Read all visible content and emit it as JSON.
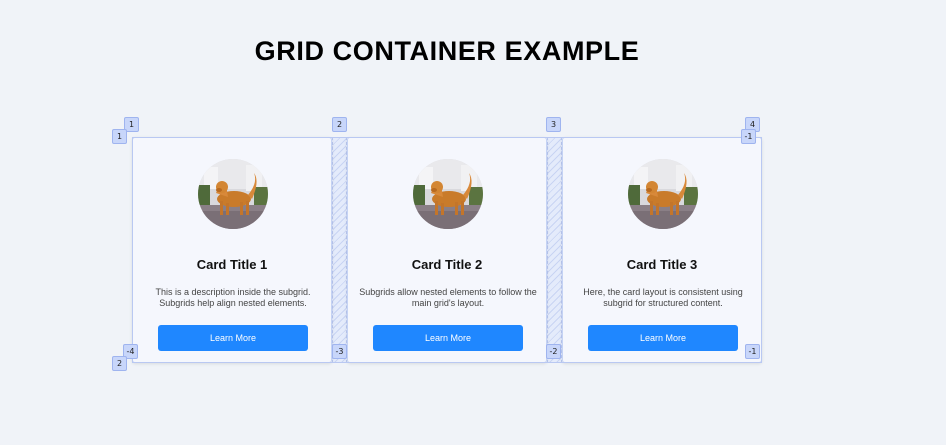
{
  "page": {
    "title": "GRID CONTAINER EXAMPLE"
  },
  "cards": [
    {
      "title": "Card Title 1",
      "description": "This is a description inside the subgrid. Subgrids help align nested elements.",
      "button_label": "Learn More",
      "image": "golden-retriever-photo"
    },
    {
      "title": "Card Title 2",
      "description": "Subgrids allow nested elements to follow the main grid's layout.",
      "button_label": "Learn More",
      "image": "golden-retriever-photo"
    },
    {
      "title": "Card Title 3",
      "description": "Here, the card layout is consistent using subgrid for structured content.",
      "button_label": "Learn More",
      "image": "golden-retriever-photo"
    }
  ],
  "grid_overlay": {
    "column_lines_top": [
      "1",
      "2",
      "3",
      "4"
    ],
    "column_lines_bottom": [
      "-4",
      "-3",
      "-2",
      "-1"
    ],
    "row_lines_left": [
      "1",
      "2"
    ],
    "row_lines_right": [
      "-1",
      "-1"
    ]
  },
  "colors": {
    "background": "#f0f3f8",
    "card_background": "#f5f7fd",
    "button": "#1f87ff",
    "grid_label": "#c8d6fa"
  }
}
